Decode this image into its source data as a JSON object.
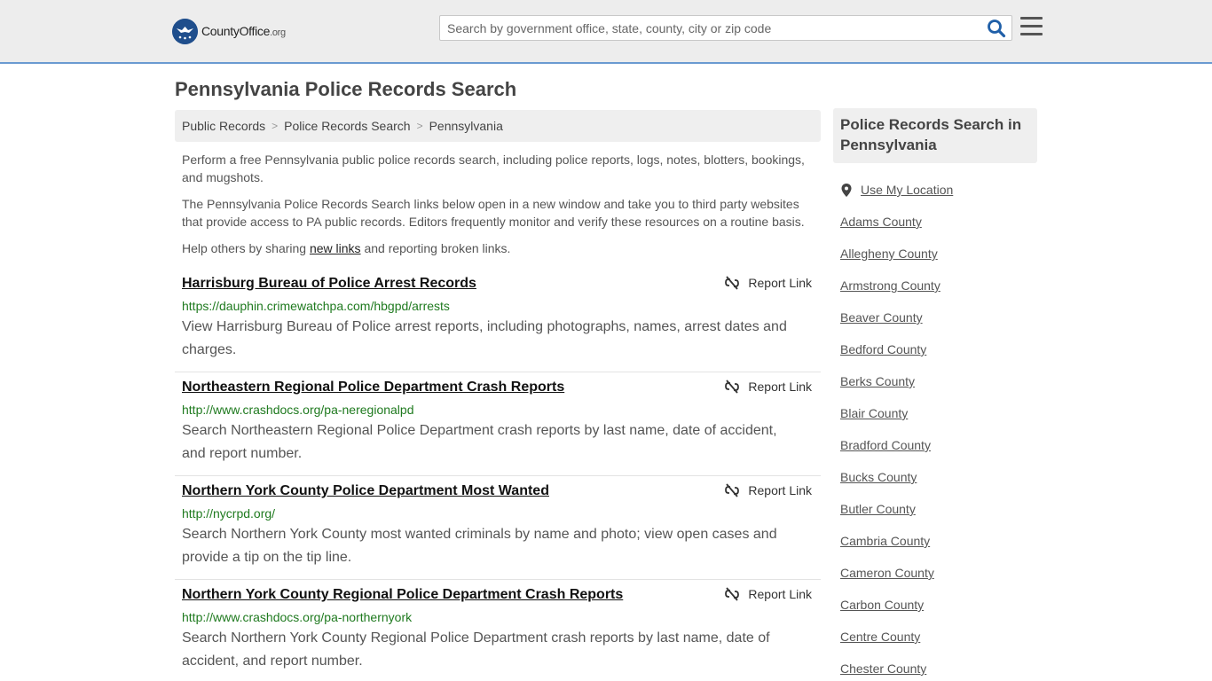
{
  "header": {
    "logo_county": "County",
    "logo_office": "Office",
    "logo_org": ".org",
    "search_placeholder": "Search by government office, state, county, city or zip code",
    "search_icon": "search-icon",
    "menu_icon": "hamburger-menu-icon"
  },
  "page": {
    "title": "Pennsylvania Police Records Search"
  },
  "breadcrumb": [
    "Public Records",
    "Police Records Search",
    "Pennsylvania"
  ],
  "intro": {
    "p1": "Perform a free Pennsylvania public police records search, including police reports, logs, notes, blotters, bookings, and mugshots.",
    "p2": "The Pennsylvania Police Records Search links below open in a new window and take you to third party websites that provide access to PA public records. Editors frequently monitor and verify these resources on a routine basis.",
    "p3_before": "Help others by sharing ",
    "p3_link": "new links",
    "p3_after": " and reporting broken links."
  },
  "report_label": "Report Link",
  "results": [
    {
      "title": "Harrisburg Bureau of Police Arrest Records",
      "url": "https://dauphin.crimewatchpa.com/hbgpd/arrests",
      "desc": "View Harrisburg Bureau of Police arrest reports, including photographs, names, arrest dates and charges."
    },
    {
      "title": "Northeastern Regional Police Department Crash Reports",
      "url": "http://www.crashdocs.org/pa-neregionalpd",
      "desc": "Search Northeastern Regional Police Department crash reports by last name, date of accident, and report number."
    },
    {
      "title": "Northern York County Police Department Most Wanted",
      "url": "http://nycrpd.org/",
      "desc": "Search Northern York County most wanted criminals by name and photo; view open cases and provide a tip on the tip line."
    },
    {
      "title": "Northern York County Regional Police Department Crash Reports",
      "url": "http://www.crashdocs.org/pa-northernyork",
      "desc": "Search Northern York County Regional Police Department crash reports by last name, date of accident, and report number."
    }
  ],
  "sidebar": {
    "heading": "Police Records Search in Pennsylvania",
    "use_location": "Use My Location",
    "counties": [
      "Adams County",
      "Allegheny County",
      "Armstrong County",
      "Beaver County",
      "Bedford County",
      "Berks County",
      "Blair County",
      "Bradford County",
      "Bucks County",
      "Butler County",
      "Cambria County",
      "Cameron County",
      "Carbon County",
      "Centre County",
      "Chester County"
    ]
  },
  "colors": {
    "header_bg": "#ededed",
    "header_border": "#6a9ad1",
    "url_green": "#1f7a1f",
    "search_icon_blue": "#1f5fa8",
    "logo_blue": "#1f4e8c"
  }
}
